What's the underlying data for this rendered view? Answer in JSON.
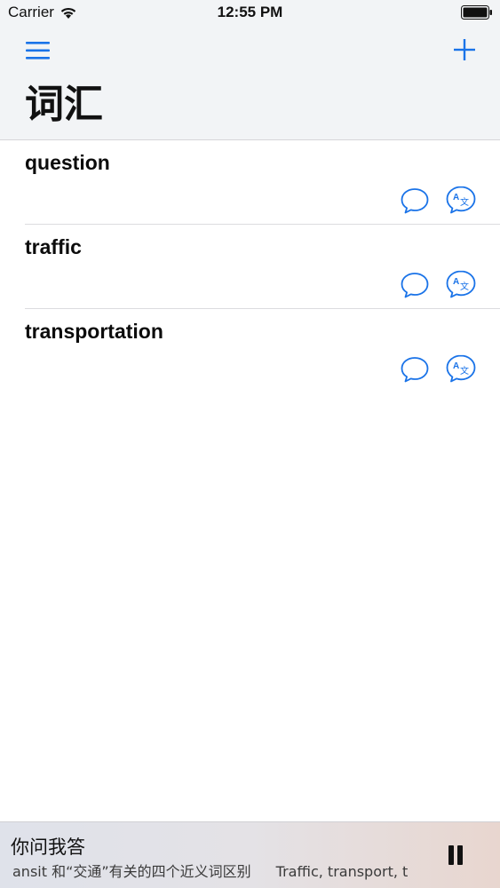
{
  "status_bar": {
    "carrier": "Carrier",
    "time": "12:55 PM"
  },
  "nav": {
    "menu_icon": "hamburger-menu-icon",
    "add_icon": "plus-icon",
    "accent_color": "#1a73e8",
    "title": "词汇"
  },
  "words": [
    {
      "word": "question"
    },
    {
      "word": "traffic"
    },
    {
      "word": "transportation"
    }
  ],
  "row_actions": {
    "speak_icon": "speech-bubble-icon",
    "translate_icon": "translate-icon"
  },
  "player": {
    "title": "你问我答",
    "subtitle_part1": "ansit 和“交通”有关的四个近义词区别",
    "subtitle_part2": "Traffic, transport, t",
    "pause_icon": "pause-icon"
  }
}
